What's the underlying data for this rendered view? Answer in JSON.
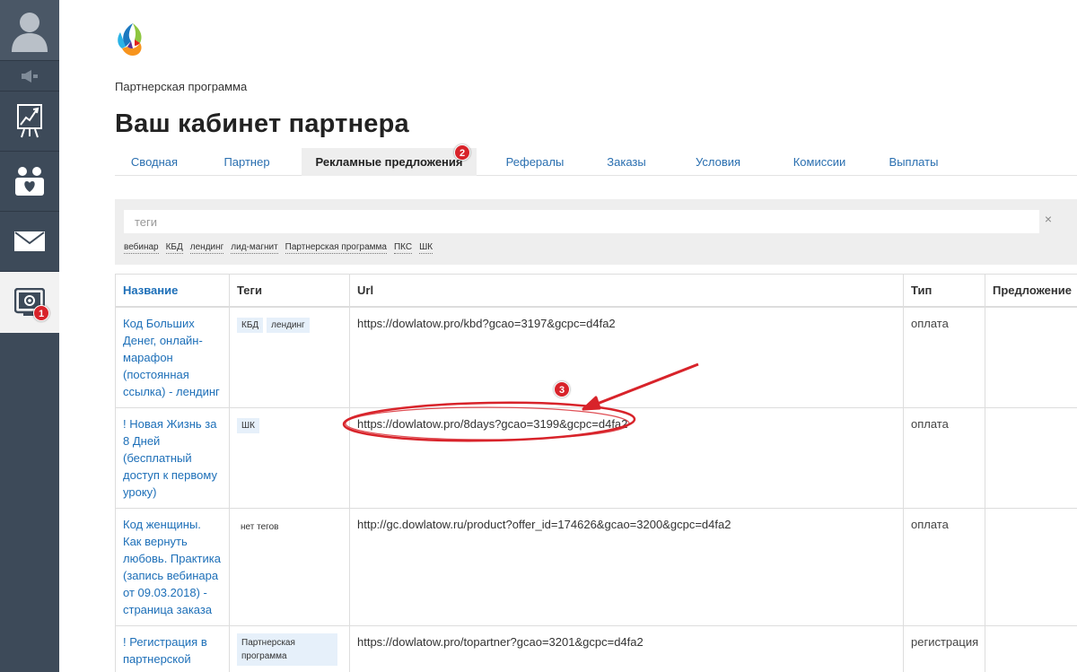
{
  "sidebar": {
    "icons": [
      "user-avatar-icon",
      "speaker-icon",
      "chart-icon",
      "family-icon",
      "mail-icon",
      "partner-settings-icon"
    ],
    "badge_1": "1"
  },
  "header": {
    "breadcrumb": "Партнерская программа",
    "title": "Ваш кабинет партнера"
  },
  "tabs": [
    {
      "label": "Сводная"
    },
    {
      "label": "Партнер"
    },
    {
      "label": "Рекламные предложения",
      "active": true
    },
    {
      "label": "Рефералы"
    },
    {
      "label": "Заказы"
    },
    {
      "label": "Условия"
    },
    {
      "label": "Комиссии"
    },
    {
      "label": "Выплаты"
    }
  ],
  "tab_badge": "2",
  "filter": {
    "placeholder": "теги",
    "clear": "×",
    "tags": [
      "вебинар",
      "КБД",
      "лендинг",
      "лид-магнит",
      "Партнерская программа",
      "ПКС",
      "ШК"
    ]
  },
  "table": {
    "headers": {
      "name": "Название",
      "tags": "Теги",
      "url": "Url",
      "type": "Тип",
      "offer": "Предложение"
    },
    "rows": [
      {
        "name": "Код Больших Денег, онлайн-марафон (постоянная ссылка) - лендинг",
        "tags": [
          "КБД",
          "лендинг"
        ],
        "url": "https://dowlatow.pro/kbd?gcao=3197&gcpc=d4fa2",
        "type": "оплата"
      },
      {
        "name": "! Новая Жизнь за 8 Дней (бесплатный доступ к первому уроку)",
        "tags": [
          "ШК"
        ],
        "url": "https://dowlatow.pro/8days?gcao=3199&gcpc=d4fa2",
        "type": "оплата"
      },
      {
        "name": "Код женщины. Как вернуть любовь. Практика (запись вебинара от 09.03.2018) - страница заказа",
        "no_tags": "нет тегов",
        "url": "http://gc.dowlatow.ru/product?offer_id=174626&gcao=3200&gcpc=d4fa2",
        "type": "оплата"
      },
      {
        "name": "! Регистрация в партнерской программе",
        "tags": [
          "Партнерская программа"
        ],
        "url": "https://dowlatow.pro/topartner?gcao=3201&gcpc=d4fa2",
        "type": "регистрация"
      }
    ]
  },
  "annotation_badge_3": "3",
  "colors": {
    "sidebar_bg": "#3d4a59",
    "link": "#1d6fb8",
    "tab_link": "#2a6fb0",
    "annotation_red": "#d8232a"
  }
}
